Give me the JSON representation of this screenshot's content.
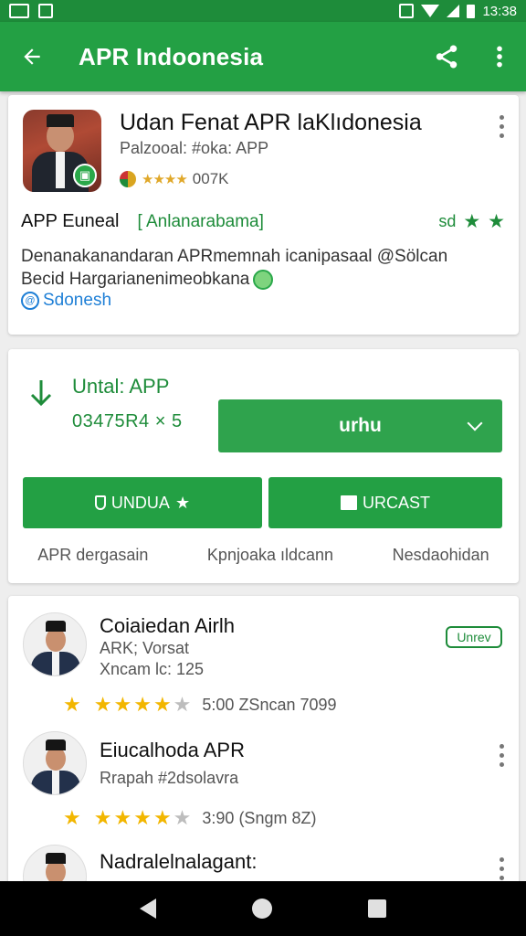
{
  "status_bar": {
    "time": "13:38"
  },
  "app_bar": {
    "title": "APR Indoonesia"
  },
  "app_card": {
    "title": "Udan Fenat APR laKlıdonesia",
    "subtitle": "Palzooal: #oka: APP",
    "rating_stars": "★★★★",
    "rating_count": "007K",
    "info_label": "APP Euneal",
    "info_tag": "[ Anlanarabama]",
    "info_right": "sd",
    "description_line1": "Denanakanandaran APRmemnah icanipasaal @Sölcan",
    "description_line2": "Becid Hargarianenimeobkana",
    "link": "Sdonesh"
  },
  "install_card": {
    "label": "Untal: APP",
    "size": "03475R4 × 5",
    "select_label": "urhu",
    "btn_unduh": "UNDUA",
    "btn_urcast": "URCAST",
    "links": [
      "APR dergasain",
      "Kpnjoaka ıldcann",
      "Nesdaohidan"
    ]
  },
  "reviews": [
    {
      "name": "Coiaiedan Airlh",
      "sub1": "ARK; Vorsat",
      "sub2": "Xncam lc: 125",
      "stars": 4,
      "meta": "5:00 ZSncan 7099",
      "badge": "Unrev"
    },
    {
      "name": "Eiucalhoda APR",
      "sub1": "Rrapah #2dsolavra",
      "sub2": "",
      "stars": 4,
      "meta": "3:90 (Sngm 8Z)"
    },
    {
      "name": "Nadralelnalagant:",
      "sub1": "",
      "sub2": ""
    }
  ],
  "colors": {
    "primary": "#23a044",
    "primary_dark": "#1e8c3a",
    "star": "#f2b600",
    "link": "#1e7fd6"
  },
  "icons": {
    "back": "arrow-back-icon",
    "share": "share-icon",
    "more": "more-vert-icon",
    "download": "download-arrow-icon"
  }
}
